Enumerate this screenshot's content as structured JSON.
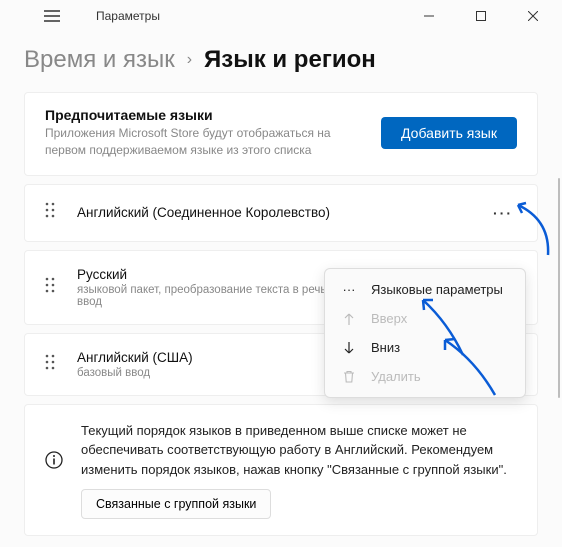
{
  "window": {
    "title": "Параметры"
  },
  "breadcrumb": {
    "parent": "Время и язык",
    "current": "Язык и регион"
  },
  "preferred": {
    "heading": "Предпочитаемые языки",
    "sub": "Приложения Microsoft Store будут отображаться на первом поддерживаемом языке из этого списка",
    "add_label": "Добавить язык"
  },
  "languages": [
    {
      "name": "Английский (Соединенное Королевство)",
      "sub": ""
    },
    {
      "name": "Русский",
      "sub": "языковой пакет, преобразование текста в речь, рукописный ввод, базовый ввод"
    },
    {
      "name": "Английский (США)",
      "sub": "базовый ввод"
    }
  ],
  "popup": {
    "options_label": "Языковые параметры",
    "up_label": "Вверх",
    "down_label": "Вниз",
    "delete_label": "Удалить"
  },
  "notice": {
    "text": "Текущий порядок языков в приведенном выше списке может не обеспечивать соответствующую работу в Английский. Рекомендуем изменить порядок языков, нажав кнопку \"Связанные с группой языки\".",
    "button": "Связанные с группой языки"
  },
  "colors": {
    "accent": "#0067c0",
    "arrow": "#0a5cd6"
  }
}
